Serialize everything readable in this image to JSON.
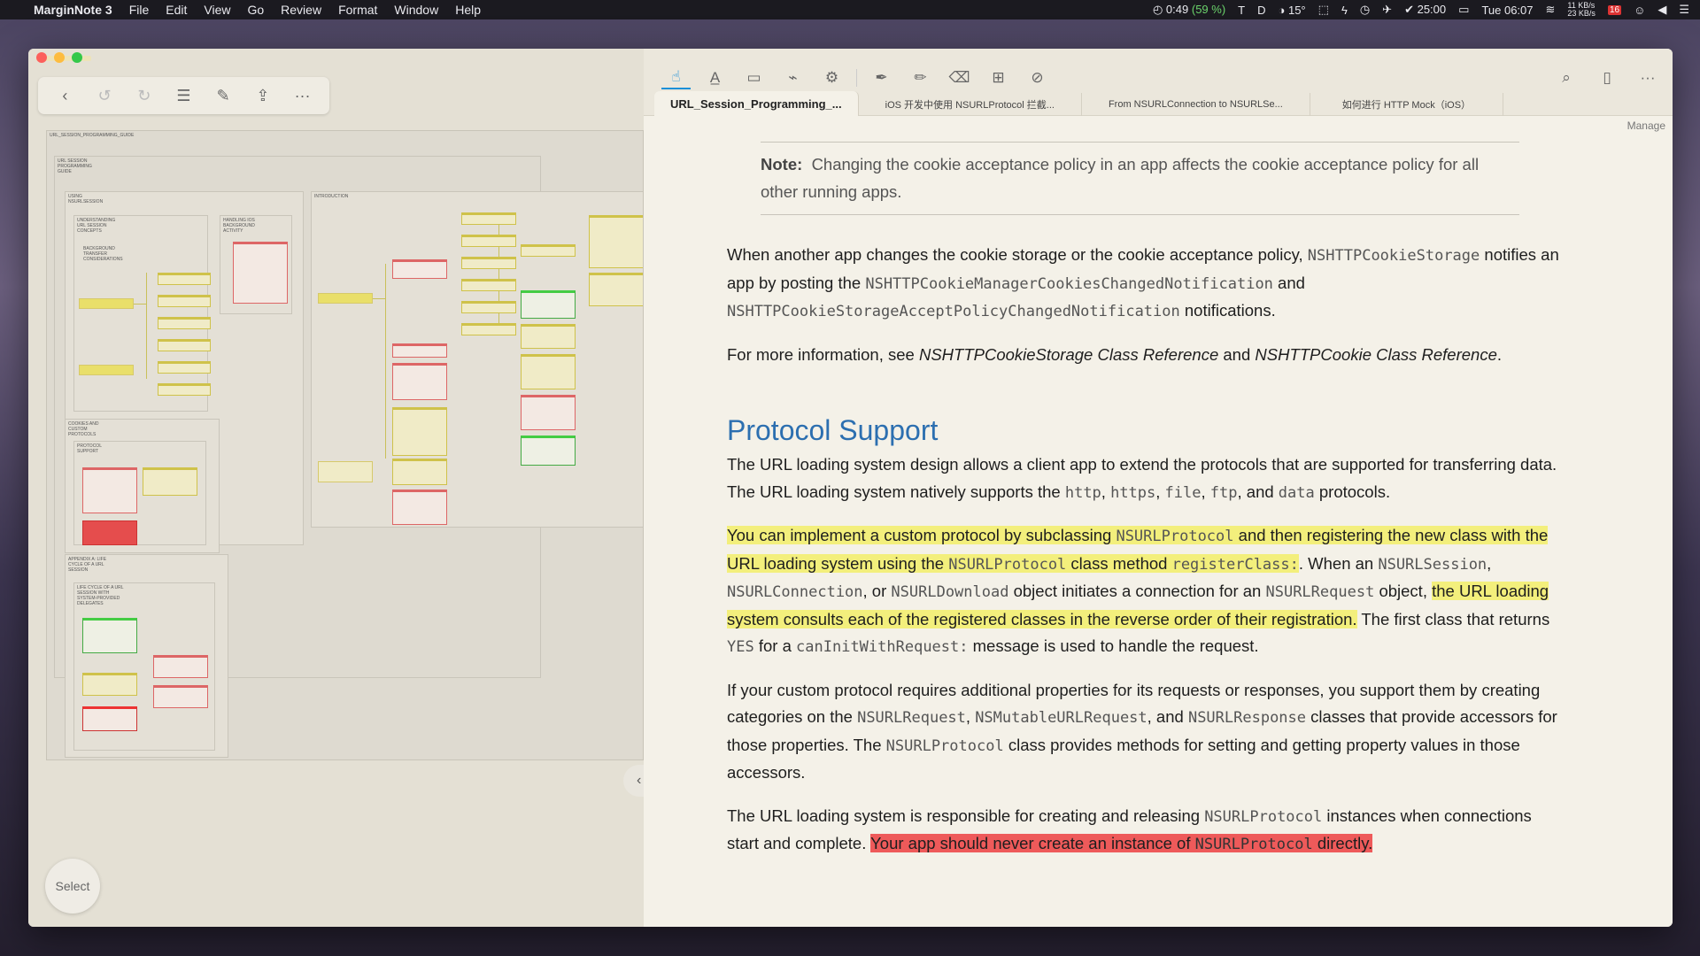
{
  "menubar": {
    "app": "MarginNote 3",
    "items": [
      "File",
      "Edit",
      "View",
      "Go",
      "Review",
      "Format",
      "Window",
      "Help"
    ],
    "status": {
      "timer": "0:49",
      "battery_pct": "(59 %)",
      "temp": "15°",
      "clock_timer": "25:00",
      "net_up": "11 KB/s",
      "net_down": "23 KB/s",
      "datetime": "Tue 06:07",
      "calendar_day": "16"
    }
  },
  "left_panel": {
    "toolbar": [
      "back-icon",
      "undo-icon",
      "redo-icon",
      "outline-icon",
      "edit-icon",
      "share-icon",
      "more-icon"
    ],
    "mindmap": {
      "root": "URL_SESSION_PROGRAMMING_GUIDE",
      "nodes": [
        "URL SESSION PROGRAMMING GUIDE",
        "USING NSURLSESSION",
        "UNDERSTANDING URL SESSION CONCEPTS",
        "BACKGROUND TRANSFER CONSIDERATIONS",
        "HANDLING IOS BACKGROUND ACTIVITY",
        "COOKIES AND CUSTOM PROTOCOLS",
        "PROTOCOL SUPPORT",
        "APPENDIX A: LIFE CYCLE OF A URL SESSION",
        "LIFE CYCLE OF A URL SESSION WITH SYSTEM-PROVIDED DELEGATES",
        "INTRODUCTION"
      ]
    },
    "select_label": "Select"
  },
  "right_panel": {
    "toolbar": [
      "hand-icon",
      "highlight-icon",
      "rect-select-icon",
      "lasso-icon",
      "screenshot-icon",
      "pen-icon",
      "marker-icon",
      "eraser-icon",
      "textbox-icon",
      "settings-icon"
    ],
    "tabs": [
      "URL_Session_Programming_...",
      "iOS 开发中使用 NSURLProtocol 拦截...",
      "From NSURLConnection to NSURLSe...",
      "如何进行 HTTP Mock（iOS）"
    ],
    "manage": "Manage",
    "doc": {
      "note_label": "Note:",
      "note_text": "Changing the cookie acceptance policy in an app affects the cookie acceptance policy for all other running apps.",
      "p1": [
        "When another app changes the cookie storage or the cookie acceptance policy, ",
        "NSHTTPCookieStorage",
        " notifies an app by posting the ",
        "NSHTTPCookieManagerCookiesChangedNotification",
        " and ",
        "NSHTTPCookieStorageAcceptPolicyChangedNotification",
        " notifications."
      ],
      "p2": [
        "For more information, see ",
        "NSHTTPCookieStorage Class Reference",
        " and ",
        "NSHTTPCookie Class Reference",
        "."
      ],
      "heading": "Protocol Support",
      "p3": [
        "The URL loading system design allows a client app to extend the protocols that are supported for transferring data. The URL loading system natively supports the ",
        "http",
        ", ",
        "https",
        ", ",
        "file",
        ", ",
        "ftp",
        ", and ",
        "data",
        " protocols."
      ],
      "p4": [
        "You can implement a custom protocol by subclassing ",
        "NSURLProtocol",
        " and then registering the new class with the URL loading system using the ",
        "NSURLProtocol",
        " class method ",
        "registerClass:",
        ". When an ",
        "NSURLSession",
        ", ",
        "NSURLConnection",
        ", or ",
        "NSURLDownload",
        " object initiates a connection for an ",
        "NSURLRequest",
        " object, ",
        "the URL loading system consults each of the registered classes in the reverse order of their registration.",
        " The first class that returns ",
        "YES",
        " for a ",
        "canInitWithRequest:",
        " message is used to handle the request."
      ],
      "p5": [
        "If your custom protocol requires additional properties for its requests or responses, you support them by creating categories on the ",
        "NSURLRequest",
        ", ",
        "NSMutableURLRequest",
        ", and ",
        "NSURLResponse",
        " classes that provide accessors for those properties. The ",
        "NSURLProtocol",
        " class provides methods for setting and getting property values in those accessors."
      ],
      "p6": [
        "The URL loading system is responsible for creating and releasing ",
        "NSURLProtocol",
        " instances when connections start and complete. ",
        "Your app should never create an instance of ",
        "NSURLProtocol",
        " directly."
      ]
    }
  },
  "colors": {
    "highlight_yellow": "#f3ef7c",
    "highlight_red": "#ee5a5a",
    "accent_blue": "#1a8fd8",
    "heading_blue": "#2c6fb0"
  }
}
